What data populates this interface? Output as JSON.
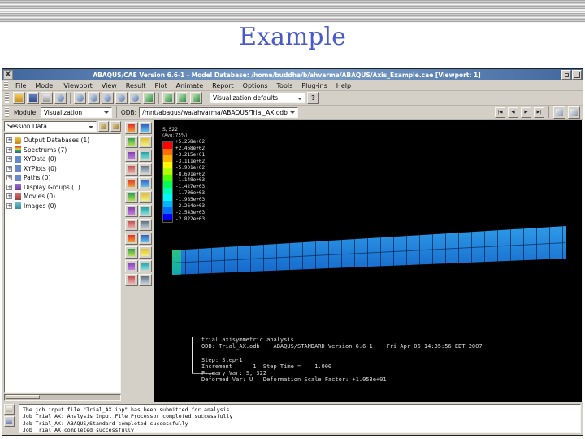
{
  "slide": {
    "title": "Example"
  },
  "window": {
    "logo": "X",
    "title": "ABAQUS/CAE Version 6.6-1 - Model Database: /home/buddha/b/ahvarma/ABAQUS/Axis_Example.cae [Viewport: 1]",
    "menus": [
      "File",
      "Model",
      "Viewport",
      "View",
      "Result",
      "Plot",
      "Animate",
      "Report",
      "Options",
      "Tools",
      "Plug-ins",
      "Help"
    ],
    "toolbar": {
      "color_code_value": "Visualization defaults",
      "help_label": "?"
    },
    "module_bar": {
      "module_label": "Module:",
      "module_value": "Visualization",
      "odb_label": "ODB:",
      "odb_value": "/mnt/abaqus/wa/ahvarma/ABAQUS/Trial_AX.odb",
      "playback": [
        "|◀",
        "◀",
        "▶",
        "▶|"
      ]
    }
  },
  "session_panel": {
    "selector_value": "Session Data",
    "expander": "+",
    "tree_items": [
      "Output Databases (1)",
      "Spectrums (7)",
      "XYData (0)",
      "XYPlots (0)",
      "Paths (0)",
      "Display Groups (1)",
      "Movies (0)",
      "Images (0)"
    ]
  },
  "viewport": {
    "legend": {
      "title": "S, S22",
      "subtitle": "(Avg: 75%)",
      "colors": [
        "#ff0000",
        "#ff6e00",
        "#ffb400",
        "#fffa00",
        "#b4ff00",
        "#50ff00",
        "#00ff5a",
        "#00ffb4",
        "#00faff",
        "#00b4ff",
        "#006eff",
        "#0000ff"
      ],
      "values": [
        "+5.258e+02",
        "+2.468e+02",
        "-3.215e+01",
        "-3.111e+02",
        "-5.901e+02",
        "-8.691e+02",
        "-1.148e+03",
        "-1.427e+03",
        "-1.706e+03",
        "-1.985e+03",
        "-2.264e+03",
        "-2.543e+03",
        "-2.822e+03"
      ]
    },
    "annotations": [
      "trial axisymmetric analysis",
      "ODB: Trial_AX.odb    ABAQUS/STANDARD Version 6.6-1    Fri Apr 06 14:35:56 EDT 2007",
      "",
      "Step: Step-1",
      "Increment      1: Step Time =    1.000",
      "Primary Var: S, S22",
      "Deformed Var: U   Deformation Scale Factor: +1.053e+01"
    ]
  },
  "message_area": {
    "lines": [
      "The job input file \"Trial_AX.inp\" has been submitted for analysis.",
      "Job Trial_AX: Analysis Input File Processor completed successfully",
      "Job Trial_AX: ABAQUS/Standard completed successfully",
      "Job Trial_AX completed successfully"
    ]
  }
}
